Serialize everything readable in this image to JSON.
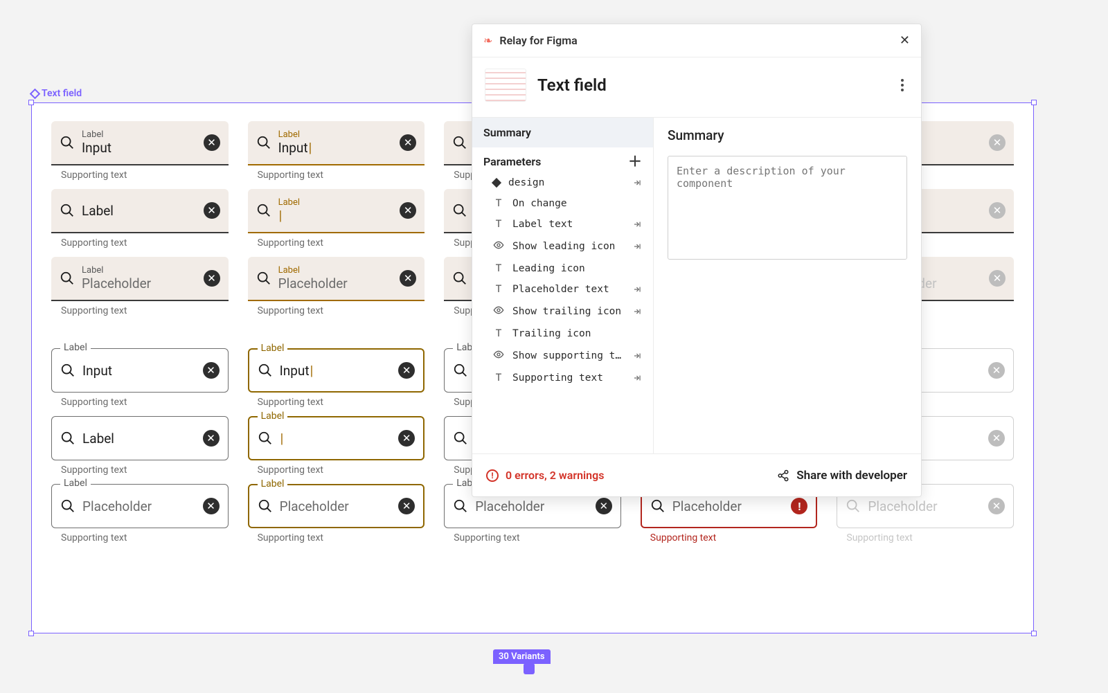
{
  "frame": {
    "name": "Text field",
    "variants_badge": "30 Variants"
  },
  "tf": {
    "label": "Label",
    "input": "Input",
    "placeholder": "Placeholder",
    "supporting": "Supporting text"
  },
  "panel": {
    "header_title": "Relay for Figma",
    "component_name": "Text field",
    "summary": "Summary",
    "parameters": "Parameters",
    "description_placeholder": "Enter a description of your component",
    "params": [
      {
        "icon": "diamond",
        "name": "design",
        "link": true
      },
      {
        "icon": "T",
        "name": "On change",
        "link": false
      },
      {
        "icon": "T",
        "name": "Label text",
        "link": true
      },
      {
        "icon": "eye",
        "name": "Show leading icon",
        "link": true
      },
      {
        "icon": "T",
        "name": "Leading icon",
        "link": false
      },
      {
        "icon": "T",
        "name": "Placeholder text",
        "link": true
      },
      {
        "icon": "eye",
        "name": "Show trailing icon",
        "link": true
      },
      {
        "icon": "T",
        "name": "Trailing icon",
        "link": false
      },
      {
        "icon": "eye",
        "name": "Show supporting t…",
        "link": true
      },
      {
        "icon": "T",
        "name": "Supporting text",
        "link": true
      }
    ],
    "errors": "0 errors, 2 warnings",
    "share": "Share with developer"
  }
}
